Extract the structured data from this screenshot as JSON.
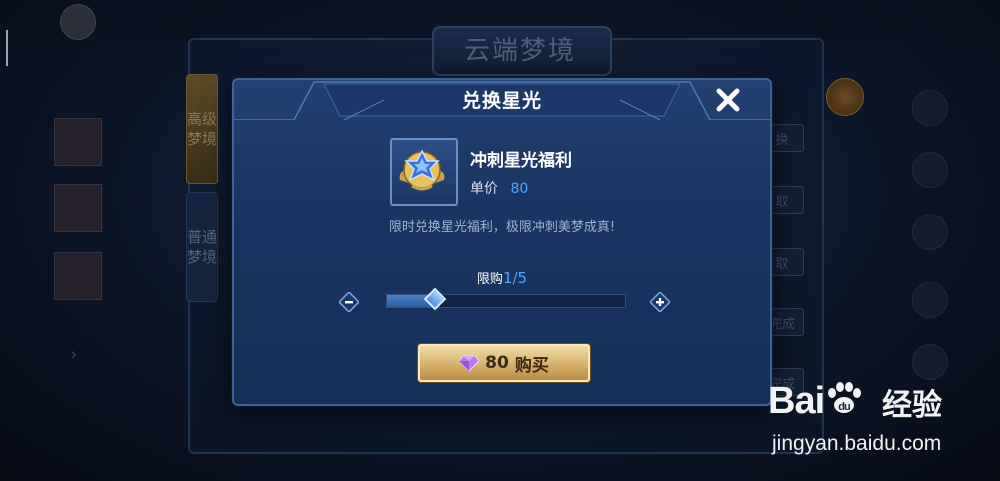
{
  "background": {
    "banner_title": "云端梦境",
    "tabs": [
      {
        "label": "高级梦境"
      },
      {
        "label": "普通梦境"
      }
    ],
    "right_buttons": [
      "换",
      "取",
      "取",
      "完成",
      "完成"
    ]
  },
  "dialog": {
    "title": "兑换星光",
    "item": {
      "name": "冲刺星光福利",
      "price_label": "单价",
      "price_value": "80",
      "icon": "star-medal-icon"
    },
    "description": "限时兑换星光福利，极限冲刺美梦成真!",
    "limit_label": "限购",
    "limit_value": "1/5",
    "quantity_fraction": 0.2,
    "buy_button": {
      "price": "80",
      "label": "购买",
      "icon": "gem-icon"
    }
  },
  "watermark": {
    "brand": "Bai",
    "brand_suffix": "经验",
    "url": "jingyan.baidu.com"
  },
  "colors": {
    "accent_blue": "#4fa6ff",
    "dialog_bg": "#1a3561",
    "button_gold": "#d6b06a"
  }
}
